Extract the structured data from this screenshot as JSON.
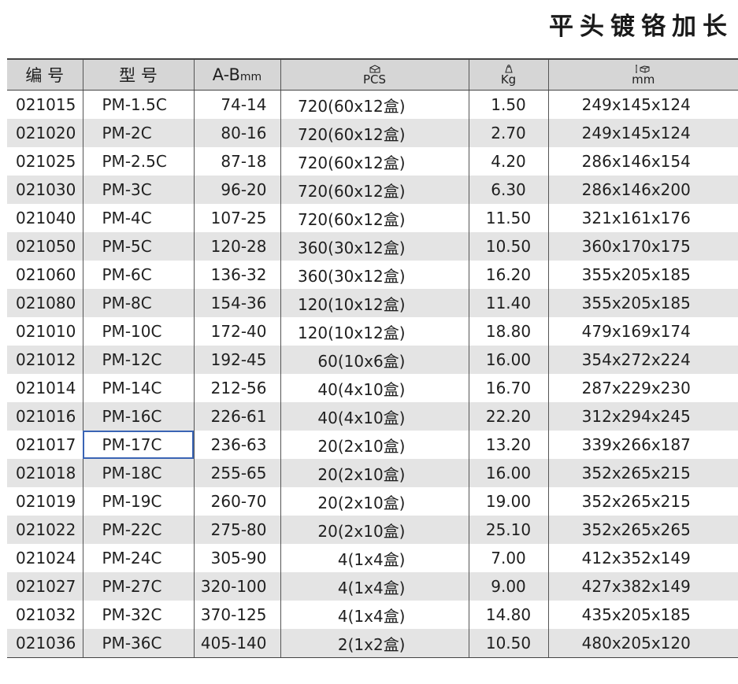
{
  "title": "平头镀铬加长",
  "table": {
    "headers": {
      "code": "编 号",
      "model": "型 号",
      "ab_main": "A-B",
      "ab_unit": "mm",
      "pcs": "PCS",
      "kg": "Kg",
      "size": "mm",
      "pcs_icon": "box-pcs-icon",
      "kg_icon": "weight-icon",
      "size_icon": "carton-size-icon"
    },
    "rows": [
      {
        "code": "021015",
        "model": "PM-1.5C",
        "ab": "74-14",
        "pcs": "720(60x12盒)",
        "kg": "1.50",
        "size": "249x145x124"
      },
      {
        "code": "021020",
        "model": "PM-2C",
        "ab": "80-16",
        "pcs": "720(60x12盒)",
        "kg": "2.70",
        "size": "249x145x124"
      },
      {
        "code": "021025",
        "model": "PM-2.5C",
        "ab": "87-18",
        "pcs": "720(60x12盒)",
        "kg": "4.20",
        "size": "286x146x154"
      },
      {
        "code": "021030",
        "model": "PM-3C",
        "ab": "96-20",
        "pcs": "720(60x12盒)",
        "kg": "6.30",
        "size": "286x146x200"
      },
      {
        "code": "021040",
        "model": "PM-4C",
        "ab": "107-25",
        "pcs": "720(60x12盒)",
        "kg": "11.50",
        "size": "321x161x176"
      },
      {
        "code": "021050",
        "model": "PM-5C",
        "ab": "120-28",
        "pcs": "360(30x12盒)",
        "kg": "10.50",
        "size": "360x170x175"
      },
      {
        "code": "021060",
        "model": "PM-6C",
        "ab": "136-32",
        "pcs": "360(30x12盒)",
        "kg": "16.20",
        "size": "355x205x185"
      },
      {
        "code": "021080",
        "model": "PM-8C",
        "ab": "154-36",
        "pcs": "120(10x12盒)",
        "kg": "11.40",
        "size": "355x205x185"
      },
      {
        "code": "021010",
        "model": "PM-10C",
        "ab": "172-40",
        "pcs": "120(10x12盒)",
        "kg": "18.80",
        "size": "479x169x174"
      },
      {
        "code": "021012",
        "model": "PM-12C",
        "ab": "192-45",
        "pcs": "60(10x6盒)",
        "kg": "16.00",
        "size": "354x272x224"
      },
      {
        "code": "021014",
        "model": "PM-14C",
        "ab": "212-56",
        "pcs": "40(4x10盒)",
        "kg": "16.70",
        "size": "287x229x230"
      },
      {
        "code": "021016",
        "model": "PM-16C",
        "ab": "226-61",
        "pcs": "40(4x10盒)",
        "kg": "22.20",
        "size": "312x294x245"
      },
      {
        "code": "021017",
        "model": "PM-17C",
        "ab": "236-63",
        "pcs": "20(2x10盒)",
        "kg": "13.20",
        "size": "339x266x187"
      },
      {
        "code": "021018",
        "model": "PM-18C",
        "ab": "255-65",
        "pcs": "20(2x10盒)",
        "kg": "16.00",
        "size": "352x265x215"
      },
      {
        "code": "021019",
        "model": "PM-19C",
        "ab": "260-70",
        "pcs": "20(2x10盒)",
        "kg": "19.00",
        "size": "352x265x215"
      },
      {
        "code": "021022",
        "model": "PM-22C",
        "ab": "275-80",
        "pcs": "20(2x10盒)",
        "kg": "25.10",
        "size": "352x265x265"
      },
      {
        "code": "021024",
        "model": "PM-24C",
        "ab": "305-90",
        "pcs": "4(1x4盒)",
        "kg": "7.00",
        "size": "412x352x149"
      },
      {
        "code": "021027",
        "model": "PM-27C",
        "ab": "320-100",
        "pcs": "4(1x4盒)",
        "kg": "9.00",
        "size": "427x382x149"
      },
      {
        "code": "021032",
        "model": "PM-32C",
        "ab": "370-125",
        "pcs": "4(1x4盒)",
        "kg": "14.80",
        "size": "435x205x185"
      },
      {
        "code": "021036",
        "model": "PM-36C",
        "ab": "405-140",
        "pcs": "2(1x2盒)",
        "kg": "10.50",
        "size": "480x205x120"
      }
    ],
    "selected_cell": {
      "row": 12,
      "column": "model"
    }
  },
  "colors": {
    "header_bg": "#d6d6d6",
    "stripe_bg": "#e4e4e4",
    "selection_outline": "#3a64b4"
  }
}
